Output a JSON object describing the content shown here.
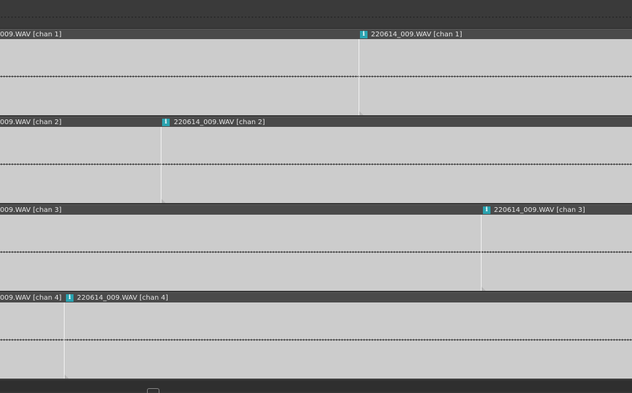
{
  "lanes": [
    {
      "left_clip_label": "009.WAV [chan 1]",
      "right_clip_label": "220614_009.WAV [chan 1]",
      "info_glyph": "i"
    },
    {
      "left_clip_label": "009.WAV [chan 2]",
      "right_clip_label": "220614_009.WAV [chan 2]",
      "info_glyph": "i"
    },
    {
      "left_clip_label": "009.WAV [chan 3]",
      "right_clip_label": "220614_009.WAV [chan 3]",
      "info_glyph": "i"
    },
    {
      "left_clip_label": "009.WAV [chan 4]",
      "right_clip_label": "220614_009.WAV [chan 4]",
      "info_glyph": "i"
    }
  ],
  "icons": {
    "info": "info-icon",
    "scroll": "scroll-grip-icon"
  },
  "colors": {
    "accent": "#2aa3b0",
    "clip_body": "#cccccc",
    "header": "#4a4a4a",
    "background": "#353535"
  }
}
